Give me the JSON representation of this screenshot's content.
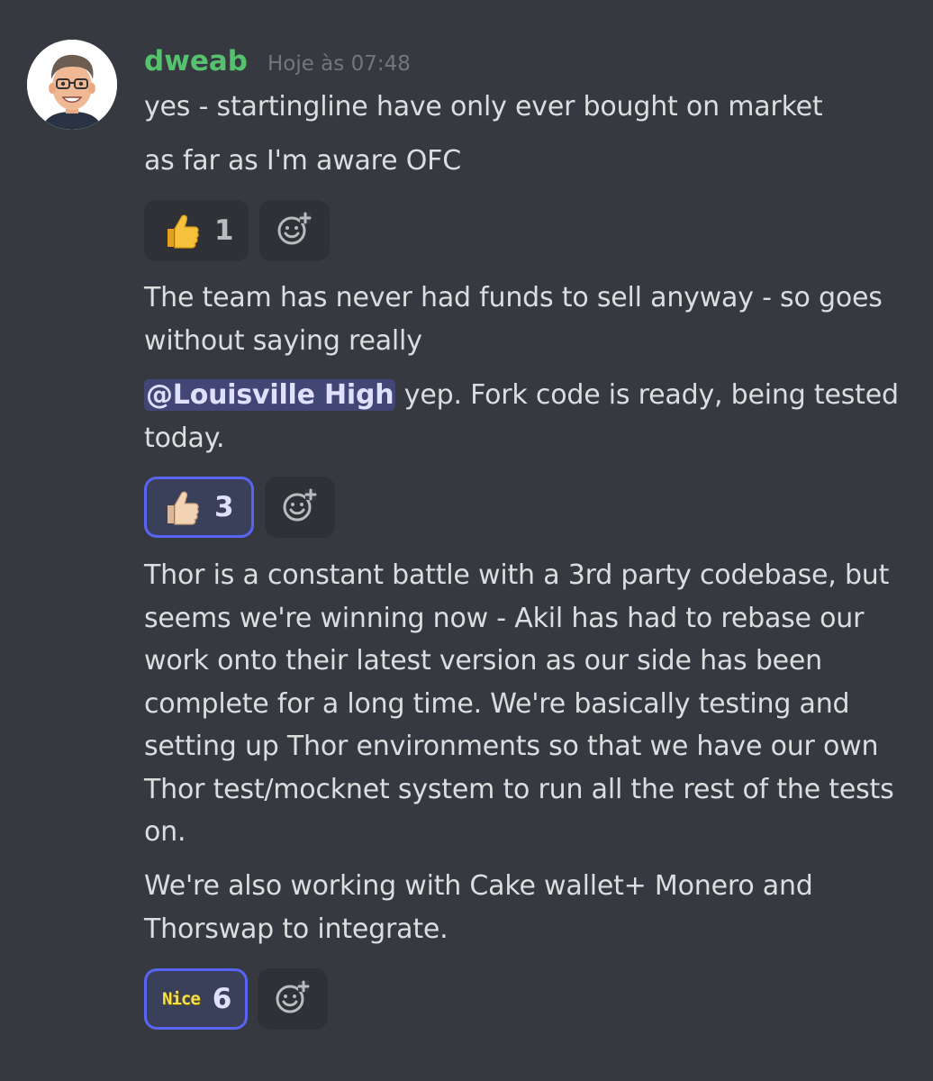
{
  "message": {
    "author": "dweab",
    "timestamp": "Hoje às 07:48",
    "colors": {
      "username": "#57c26d",
      "background": "#36393f",
      "reaction_active_border": "#5865f2",
      "mention_background": "#414675"
    }
  },
  "lines": {
    "line1": "yes - startingline have only ever bought on market",
    "line2": "as far as I'm aware OFC",
    "line3": "The team has never had funds to sell anyway - so goes without saying really",
    "line4_mention": "@Louisville High",
    "line4_rest": " yep. Fork code is ready, being tested today.",
    "line5": "Thor is a constant battle with a 3rd party codebase, but seems we're winning now - Akil has had to rebase our work onto their latest version as our side has been complete for a long time. We're basically testing and setting up Thor environments so that we have our own Thor test/mocknet system to run all the rest of the tests on.",
    "line6": "We're also working with Cake wallet+ Monero and Thorswap to integrate."
  },
  "reactions": {
    "r1": {
      "emoji": "thumbs-up-yellow-icon",
      "count": "1",
      "active": false
    },
    "r2": {
      "emoji": "thumbs-up-light-skin-icon",
      "count": "3",
      "active": true
    },
    "r3": {
      "emoji": "nice-emoji",
      "emoji_text": "Nice",
      "count": "6",
      "active": true
    }
  },
  "icons": {
    "add_reaction": "add-reaction-icon"
  }
}
